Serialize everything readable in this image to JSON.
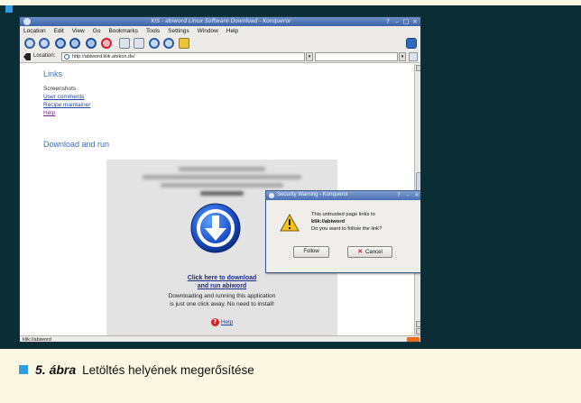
{
  "window": {
    "title": "KIS - abiword Linux Software Download - Konqueror",
    "controls": [
      "?",
      "–",
      "□",
      "×"
    ]
  },
  "menubar": {
    "items": [
      "Location",
      "Edit",
      "View",
      "Go",
      "Bookmarks",
      "Tools",
      "Settings",
      "Window",
      "Help"
    ]
  },
  "location_bar": {
    "label": "Location:",
    "url": "http://abiword.klik.atekon.de/",
    "dropdown_glyph": "▾"
  },
  "page": {
    "links_heading": "Links",
    "links": {
      "screenshots": "Screenshots",
      "user_comments": "User comments",
      "recipe_maintainer": "Recipe maintainer",
      "help": "Help"
    },
    "download_heading": "Download and run",
    "download_panel": {
      "link_line1": "Click here to download",
      "link_line2": "and run abiword",
      "desc_line1": "Downloading and running this application",
      "desc_line2": "is just one click away. No need to install!",
      "help_glyph": "?",
      "help_label": "Help"
    }
  },
  "statusbar": {
    "text": "klik://abiword"
  },
  "dialog": {
    "title": "Security Warning - Konqueror",
    "title_controls": [
      "?",
      "–",
      "×"
    ],
    "message_line1": "This untrusted page links to",
    "message_line2": "klik://abiword",
    "message_line3": "Do you want to follow the link?",
    "follow_label": "Follow",
    "cancel_glyph": "✕",
    "cancel_label": "Cancel"
  },
  "caption": {
    "number": "5. ábra",
    "text": "Letöltés helyének megerősítése"
  },
  "colors": {
    "dark_panel": "#0b2d36",
    "accent_blue": "#2d9fe0",
    "page_background": "#fdf8e4"
  }
}
